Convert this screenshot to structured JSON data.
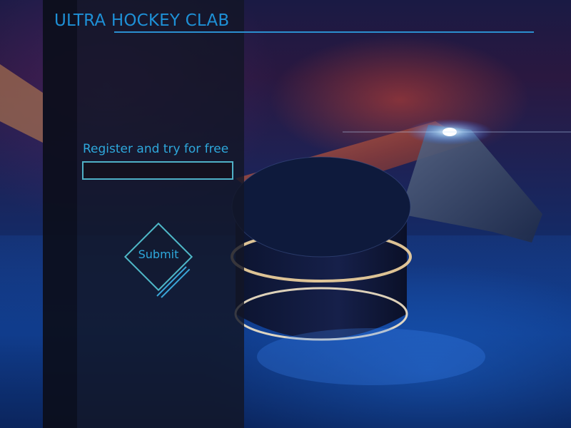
{
  "header": {
    "title": "ULTRA HOCKEY CLAB"
  },
  "form": {
    "label": "Register and try for free",
    "input_value": "",
    "submit_label": "Submit"
  },
  "colors": {
    "accent": "#1e90d6",
    "input_border": "#4fb0c6",
    "panel_background": "#121626"
  }
}
